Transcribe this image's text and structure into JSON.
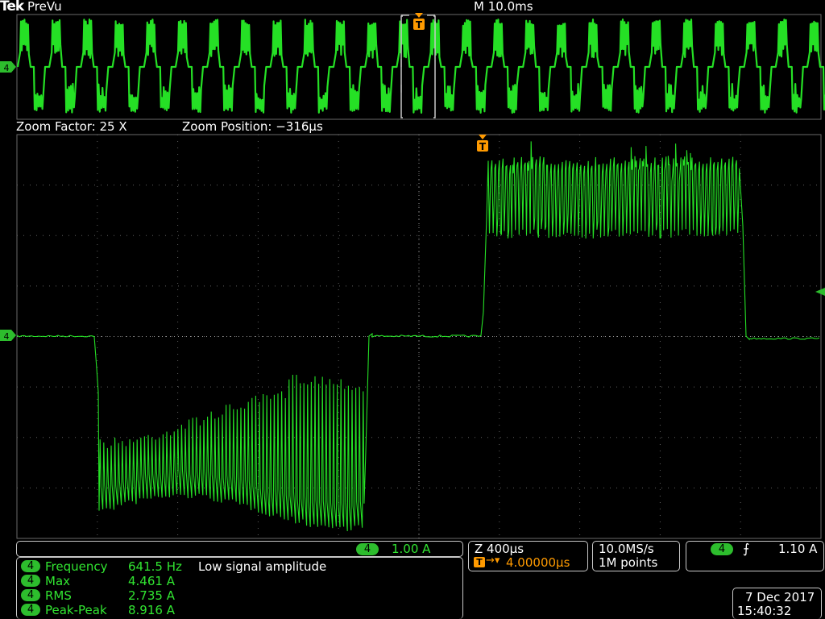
{
  "header": {
    "brand": "Tek",
    "mode": "PreVu",
    "main_timebase": "M 10.0ms"
  },
  "zoom": {
    "factor_label": "Zoom Factor: 25 X",
    "position_label": "Zoom Position: −316µs"
  },
  "channel": {
    "id": "4",
    "scale": "1.00 A"
  },
  "horizontal": {
    "zoom_scale": "Z 400µs",
    "trigger_delay": "4.00000µs"
  },
  "acquisition": {
    "sample_rate": "10.0MS/s",
    "record_length": "1M points"
  },
  "trigger": {
    "channel": "4",
    "slope_symbol": "⨍",
    "level": "1.10 A"
  },
  "measurements": [
    {
      "channel": "4",
      "label": "Frequency",
      "value": "641.5 Hz",
      "note": "Low signal amplitude"
    },
    {
      "channel": "4",
      "label": "Max",
      "value": "4.461 A",
      "note": ""
    },
    {
      "channel": "4",
      "label": "RMS",
      "value": "2.735 A",
      "note": ""
    },
    {
      "channel": "4",
      "label": "Peak-Peak",
      "value": "8.916 A",
      "note": ""
    }
  ],
  "datetime": {
    "date": "7 Dec  2017",
    "time": "15:40:32"
  },
  "colors": {
    "trace": "#25e025",
    "trigger": "#ff9a00",
    "grid": "#606060",
    "background": "#000000"
  }
}
